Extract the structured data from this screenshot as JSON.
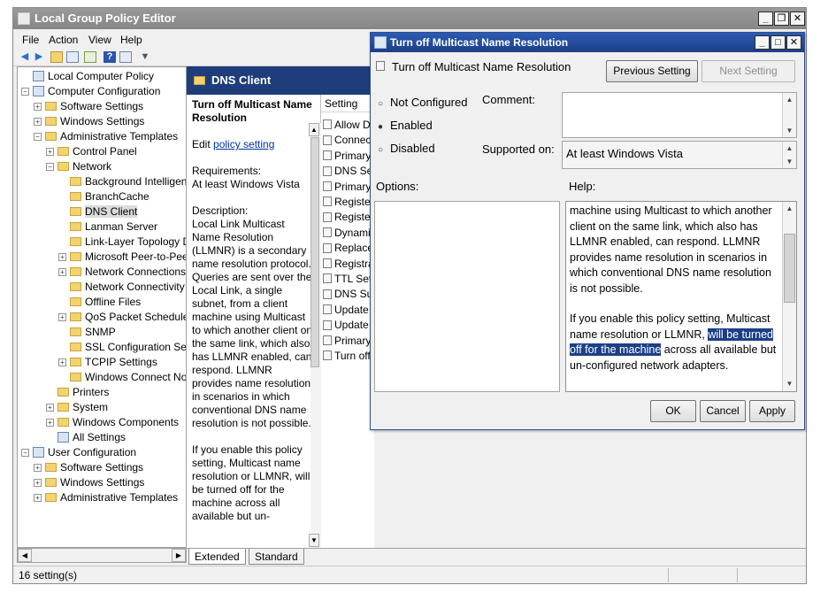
{
  "main_window": {
    "title": "Local Group Policy Editor",
    "controls": {
      "minimize": "_",
      "restore": "❐",
      "close": "✕"
    }
  },
  "menu": [
    "File",
    "Action",
    "View",
    "Help"
  ],
  "tree": [
    {
      "label": "Local Computer Policy",
      "level": 0,
      "expander": "",
      "icon": "computer-policy-icon"
    },
    {
      "label": "Computer Configuration",
      "level": 0,
      "expander": "⊟",
      "icon": "computer-icon"
    },
    {
      "label": "Software Settings",
      "level": 1,
      "expander": "⊞",
      "icon": "folder-icon"
    },
    {
      "label": "Windows Settings",
      "level": 1,
      "expander": "⊞",
      "icon": "folder-icon"
    },
    {
      "label": "Administrative Templates",
      "level": 1,
      "expander": "⊟",
      "icon": "folder-icon"
    },
    {
      "label": "Control Panel",
      "level": 2,
      "expander": "⊞",
      "icon": "folder-icon"
    },
    {
      "label": "Network",
      "level": 2,
      "expander": "⊟",
      "icon": "folder-icon"
    },
    {
      "label": "Background Intelligent",
      "level": 3,
      "expander": "",
      "icon": "folder-icon"
    },
    {
      "label": "BranchCache",
      "level": 3,
      "expander": "",
      "icon": "folder-icon"
    },
    {
      "label": "DNS Client",
      "level": 3,
      "expander": "",
      "icon": "folder-icon",
      "selected": true
    },
    {
      "label": "Lanman Server",
      "level": 3,
      "expander": "",
      "icon": "folder-icon"
    },
    {
      "label": "Link-Layer Topology Di",
      "level": 3,
      "expander": "",
      "icon": "folder-icon"
    },
    {
      "label": "Microsoft Peer-to-Peer",
      "level": 3,
      "expander": "⊞",
      "icon": "folder-icon"
    },
    {
      "label": "Network Connections",
      "level": 3,
      "expander": "⊞",
      "icon": "folder-icon"
    },
    {
      "label": "Network Connectivity S",
      "level": 3,
      "expander": "",
      "icon": "folder-icon"
    },
    {
      "label": "Offline Files",
      "level": 3,
      "expander": "",
      "icon": "folder-icon"
    },
    {
      "label": "QoS Packet Scheduler",
      "level": 3,
      "expander": "⊞",
      "icon": "folder-icon"
    },
    {
      "label": "SNMP",
      "level": 3,
      "expander": "",
      "icon": "folder-icon"
    },
    {
      "label": "SSL Configuration Setti",
      "level": 3,
      "expander": "",
      "icon": "folder-icon"
    },
    {
      "label": "TCPIP Settings",
      "level": 3,
      "expander": "⊞",
      "icon": "folder-icon"
    },
    {
      "label": "Windows Connect Now",
      "level": 3,
      "expander": "",
      "icon": "folder-icon"
    },
    {
      "label": "Printers",
      "level": 2,
      "expander": "",
      "icon": "folder-icon"
    },
    {
      "label": "System",
      "level": 2,
      "expander": "⊞",
      "icon": "folder-icon"
    },
    {
      "label": "Windows Components",
      "level": 2,
      "expander": "⊞",
      "icon": "folder-icon"
    },
    {
      "label": "All Settings",
      "level": 2,
      "expander": "",
      "icon": "all-settings-icon"
    },
    {
      "label": "User Configuration",
      "level": 0,
      "expander": "⊟",
      "icon": "user-icon"
    },
    {
      "label": "Software Settings",
      "level": 1,
      "expander": "⊞",
      "icon": "folder-icon"
    },
    {
      "label": "Windows Settings",
      "level": 1,
      "expander": "⊞",
      "icon": "folder-icon"
    },
    {
      "label": "Administrative Templates",
      "level": 1,
      "expander": "⊞",
      "icon": "folder-icon"
    }
  ],
  "description": {
    "header": "DNS Client",
    "policy_title": "Turn off Multicast Name Resolution",
    "edit_prefix": "Edit ",
    "edit_link": "policy setting",
    "requirements_label": "Requirements:",
    "requirements_value": "At least Windows Vista",
    "description_label": "Description:",
    "description_text": "Local Link Multicast Name Resolution (LLMNR) is a secondary name resolution protocol. Queries are sent over the Local Link, a single subnet, from a client machine using Multicast to which another client on the same link, which also has LLMNR enabled, can respond. LLMNR provides name resolution in scenarios in which conventional DNS name resolution is not possible.",
    "enable_text": "If you enable this policy setting, Multicast name resolution or LLMNR, will be turned off for the machine across all available but un-"
  },
  "settings_list": {
    "header": "Setting",
    "items": [
      "Allow D",
      "Connect",
      "Primary",
      "DNS Ser",
      "Primary",
      "Registe",
      "Registe",
      "Dynami",
      "Replace",
      "Registra",
      "TTL Set",
      "DNS Suf",
      "Update",
      "Update",
      "Primary",
      "Turn off"
    ]
  },
  "tabs": [
    "Extended",
    "Standard"
  ],
  "status": "16 setting(s)",
  "dialog": {
    "title": "Turn off Multicast Name Resolution",
    "controls": {
      "minimize": "_",
      "maximize": "□",
      "close": "✕"
    },
    "setting_name": "Turn off Multicast Name Resolution",
    "previous_button": "Previous Setting",
    "next_button": "Next Setting",
    "radios": [
      "Not Configured",
      "Enabled",
      "Disabled"
    ],
    "selected_radio": "Enabled",
    "comment_label": "Comment:",
    "supported_label": "Supported on:",
    "supported_value": "At least Windows Vista",
    "options_label": "Options:",
    "help_label": "Help:",
    "help_para1": "machine using Multicast to which another client on the same link, which also has LLMNR enabled, can respond. LLMNR provides name resolution in scenarios in which conventional DNS name resolution is not possible.",
    "help_para2_pre": "If you enable this policy setting, Multicast name resolution or LLMNR, ",
    "help_para2_highlight": "will be turned off for the machine",
    "help_para2_post": " across all available but un-configured network adapters.",
    "ok": "OK",
    "cancel": "Cancel",
    "apply": "Apply"
  }
}
